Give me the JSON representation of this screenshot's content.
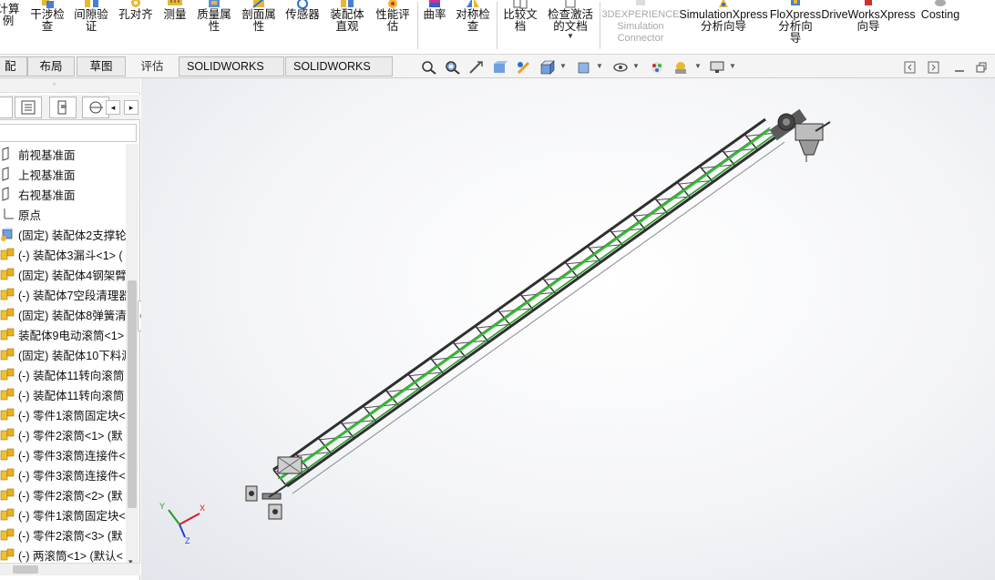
{
  "ribbon": {
    "items": [
      {
        "label": "计算\n例",
        "name": "calc-button"
      },
      {
        "label": "干涉检\n查",
        "name": "interference-check-button"
      },
      {
        "label": "间隙验\n证",
        "name": "clearance-verify-button"
      },
      {
        "label": "孔对齐",
        "name": "hole-align-button"
      },
      {
        "label": "测量",
        "name": "measure-button"
      },
      {
        "label": "质量属\n性",
        "name": "mass-properties-button"
      },
      {
        "label": "剖面属\n性",
        "name": "section-properties-button"
      },
      {
        "label": "传感器",
        "name": "sensor-button"
      },
      {
        "label": "装配体\n直观",
        "name": "assemblyxpert-button"
      },
      {
        "label": "性能评\n估",
        "name": "performance-eval-button"
      },
      {
        "label": "曲率",
        "name": "curvature-button"
      },
      {
        "label": "对称检\n查",
        "name": "symmetry-check-button"
      },
      {
        "label": "比较文\n档",
        "name": "compare-docs-button"
      },
      {
        "label": "检查激活\n的文档",
        "name": "check-active-doc-button"
      },
      {
        "label": "3DEXPERIENCE\nSimulation\nConnector",
        "name": "3dx-sim-connector-button"
      },
      {
        "label": "SimulationXpress\n分析向导",
        "name": "simulationxpress-button"
      },
      {
        "label": "FloXpress\n分析向\n导",
        "name": "floxpress-button"
      },
      {
        "label": "DriveWorksXpress\n向导",
        "name": "driveworksxpress-button"
      },
      {
        "label": "Costing",
        "name": "costing-button"
      }
    ]
  },
  "tabs": [
    {
      "label": "配体"
    },
    {
      "label": "布局"
    },
    {
      "label": "草图"
    },
    {
      "label": "评估"
    },
    {
      "label": "SOLIDWORKS 插件"
    },
    {
      "label": "SOLIDWORKS MBD"
    }
  ],
  "tree": {
    "items": [
      {
        "label": "前视基准面",
        "icon": "plane-icon"
      },
      {
        "label": "上视基准面",
        "icon": "plane-icon"
      },
      {
        "label": "右视基准面",
        "icon": "plane-icon"
      },
      {
        "label": "原点",
        "icon": "origin-icon"
      },
      {
        "label": "(固定) 装配体2支撑轮",
        "icon": "part-icon"
      },
      {
        "label": "(-) 装配体3漏斗<1> (",
        "icon": "assembly-icon"
      },
      {
        "label": "(固定) 装配体4钢架臂",
        "icon": "assembly-icon"
      },
      {
        "label": "(-) 装配体7空段清理器",
        "icon": "assembly-icon"
      },
      {
        "label": "(固定) 装配体8弹簧清:",
        "icon": "assembly-icon"
      },
      {
        "label": "装配体9电动滚筒<1>",
        "icon": "assembly-icon"
      },
      {
        "label": "(固定) 装配体10下料漏",
        "icon": "assembly-icon"
      },
      {
        "label": "(-) 装配体11转向滚筒",
        "icon": "assembly-icon"
      },
      {
        "label": "(-) 装配体11转向滚筒",
        "icon": "assembly-icon"
      },
      {
        "label": "(-) 零件1滚筒固定块<",
        "icon": "assembly-icon"
      },
      {
        "label": "(-) 零件2滚筒<1> (默",
        "icon": "assembly-icon"
      },
      {
        "label": "(-) 零件3滚筒连接件<",
        "icon": "assembly-icon"
      },
      {
        "label": "(-) 零件3滚筒连接件<",
        "icon": "assembly-icon"
      },
      {
        "label": "(-) 零件2滚筒<2> (默",
        "icon": "assembly-icon"
      },
      {
        "label": "(-) 零件1滚筒固定块<",
        "icon": "assembly-icon"
      },
      {
        "label": "(-) 零件2滚筒<3> (默",
        "icon": "assembly-icon"
      },
      {
        "label": "(-) 两滚筒<1> (默认<",
        "icon": "assembly-icon"
      }
    ]
  },
  "triad": {
    "x": "X",
    "y": "Y",
    "z": "Z"
  },
  "colors": {
    "accent_green": "#2fbf2f",
    "frame": "#3a3a3a",
    "ribbon_bg": "#ffffff",
    "viewport_bg": "#eceef3"
  }
}
